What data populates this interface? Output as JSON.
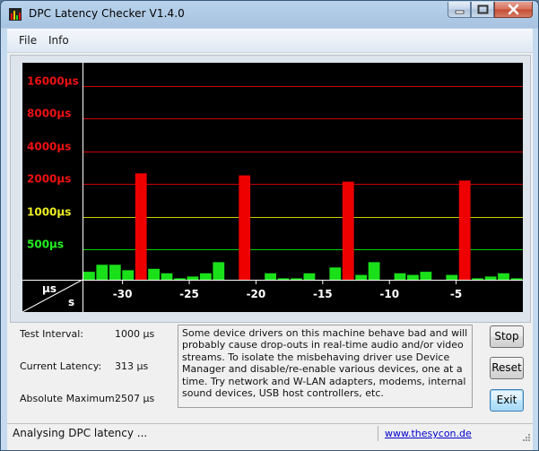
{
  "window": {
    "title": "DPC Latency Checker V1.4.0"
  },
  "menu": [
    "File",
    "Info"
  ],
  "chart_data": {
    "type": "bar",
    "y_labels": [
      {
        "text": "16000µs",
        "color": "#ee1111"
      },
      {
        "text": "8000µs",
        "color": "#ee1111"
      },
      {
        "text": "4000µs",
        "color": "#ee1111"
      },
      {
        "text": "2000µs",
        "color": "#ee1111"
      },
      {
        "text": "1000µs",
        "color": "#eeee22"
      },
      {
        "text": "500µs",
        "color": "#22ee22"
      }
    ],
    "gridline_colors": [
      "#cc0000",
      "#cc0000",
      "#cc0000",
      "#cc0000",
      "#cccc00",
      "#00cc00"
    ],
    "corner_labels": {
      "top": "µs",
      "bottom": "s"
    },
    "x_ticks": [
      "-30",
      "-25",
      "-20",
      "-15",
      "-10",
      "-5"
    ],
    "x_range": [
      -33,
      0
    ],
    "values_us": [
      310,
      360,
      360,
      320,
      2507,
      330,
      300,
      270,
      280,
      300,
      380,
      260,
      2400,
      260,
      300,
      270,
      270,
      300,
      260,
      340,
      2100,
      290,
      380,
      250,
      300,
      290,
      310,
      260,
      290,
      2150,
      270,
      280,
      300,
      270
    ]
  },
  "stats": [
    {
      "label": "Test Interval:",
      "value": "1000 µs"
    },
    {
      "label": "Current Latency:",
      "value": "313 µs"
    },
    {
      "label": "Absolute Maximum:",
      "value": "2507 µs"
    }
  ],
  "info_text": "Some device drivers on this machine behave bad and will probably cause drop-outs in real-time audio and/or video streams. To isolate the misbehaving driver use Device Manager and disable/re-enable various devices, one at a time. Try network and W-LAN adapters, modems, internal sound devices, USB host controllers, etc.",
  "buttons": {
    "stop": "Stop",
    "reset": "Reset",
    "exit": "Exit"
  },
  "status": {
    "text": "Analysing DPC latency ...",
    "link": "www.thesycon.de"
  },
  "colors": {
    "bar_normal": "#1ae01a",
    "bar_high": "#ee0000",
    "background": "#000000",
    "axis": "#ffffff"
  }
}
